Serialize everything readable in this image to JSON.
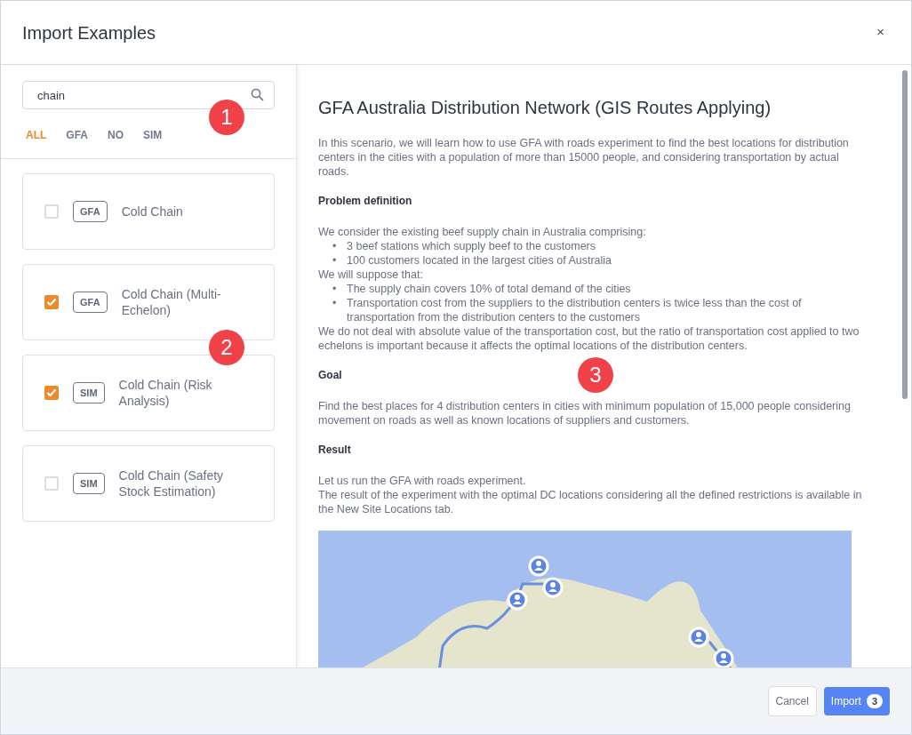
{
  "dialog": {
    "title": "Import Examples",
    "close": "×"
  },
  "search": {
    "value": "chain"
  },
  "filters": [
    {
      "label": "ALL",
      "selected": true
    },
    {
      "label": "GFA",
      "selected": false
    },
    {
      "label": "NO",
      "selected": false
    },
    {
      "label": "SIM",
      "selected": false
    }
  ],
  "examples": [
    {
      "tag": "GFA",
      "name": "Cold Chain",
      "checked": false
    },
    {
      "tag": "GFA",
      "name": "Cold Chain (Multi-Echelon)",
      "checked": true
    },
    {
      "tag": "SIM",
      "name": "Cold Chain (Risk Analysis)",
      "checked": true
    },
    {
      "tag": "SIM",
      "name": "Cold Chain (Safety Stock Estimation)",
      "checked": false
    }
  ],
  "detail": {
    "title": "GFA Australia Distribution Network (GIS Routes Applying)",
    "blocks": [
      {
        "kind": "paragraph",
        "text": "In this scenario, we will learn how to use GFA with roads experiment to find the best locations for distribution centers in the cities with a population of more than 15000 people, and considering transportation by actual roads."
      },
      {
        "kind": "heading",
        "text": "Problem definition"
      },
      {
        "kind": "line",
        "text": "We consider the existing beef supply chain in Australia comprising:"
      },
      {
        "kind": "list",
        "items": [
          {
            "marker": "•",
            "text": "3 beef stations which supply beef to the customers"
          },
          {
            "marker": "•",
            "text": "100 customers located in the largest cities of Australia"
          }
        ]
      },
      {
        "kind": "line",
        "text": "We will suppose that:"
      },
      {
        "kind": "list",
        "items": [
          {
            "marker": "•",
            "text": "The supply chain covers 10% of total demand of the cities"
          },
          {
            "marker": "•",
            "text": "Transportation cost from the suppliers to the distribution centers is twice less than the cost of transportation from the distribution centers to the customers"
          }
        ]
      },
      {
        "kind": "paragraph",
        "text": "We do not deal with absolute value of the transportation cost, but the ratio of transportation cost applied to two echelons is important because it affects the optimal locations of the distribution centers."
      },
      {
        "kind": "heading",
        "text": "Goal"
      },
      {
        "kind": "paragraph",
        "text": "Find the best places for 4 distribution centers in cities with minimum population of 15,000 people considering movement on roads as well as known locations of suppliers and customers."
      },
      {
        "kind": "heading",
        "text": "Result"
      },
      {
        "kind": "line",
        "text": "Let us run the GFA with roads experiment."
      },
      {
        "kind": "paragraph",
        "text": "The result of the experiment with the optimal DC locations considering all the defined restrictions is available in the New Site Locations tab."
      },
      {
        "kind": "map"
      }
    ]
  },
  "footer": {
    "cancel": "Cancel",
    "import": "Import",
    "import_count": "3"
  },
  "callouts": [
    {
      "label": "1"
    },
    {
      "label": "2"
    },
    {
      "label": "3"
    }
  ]
}
